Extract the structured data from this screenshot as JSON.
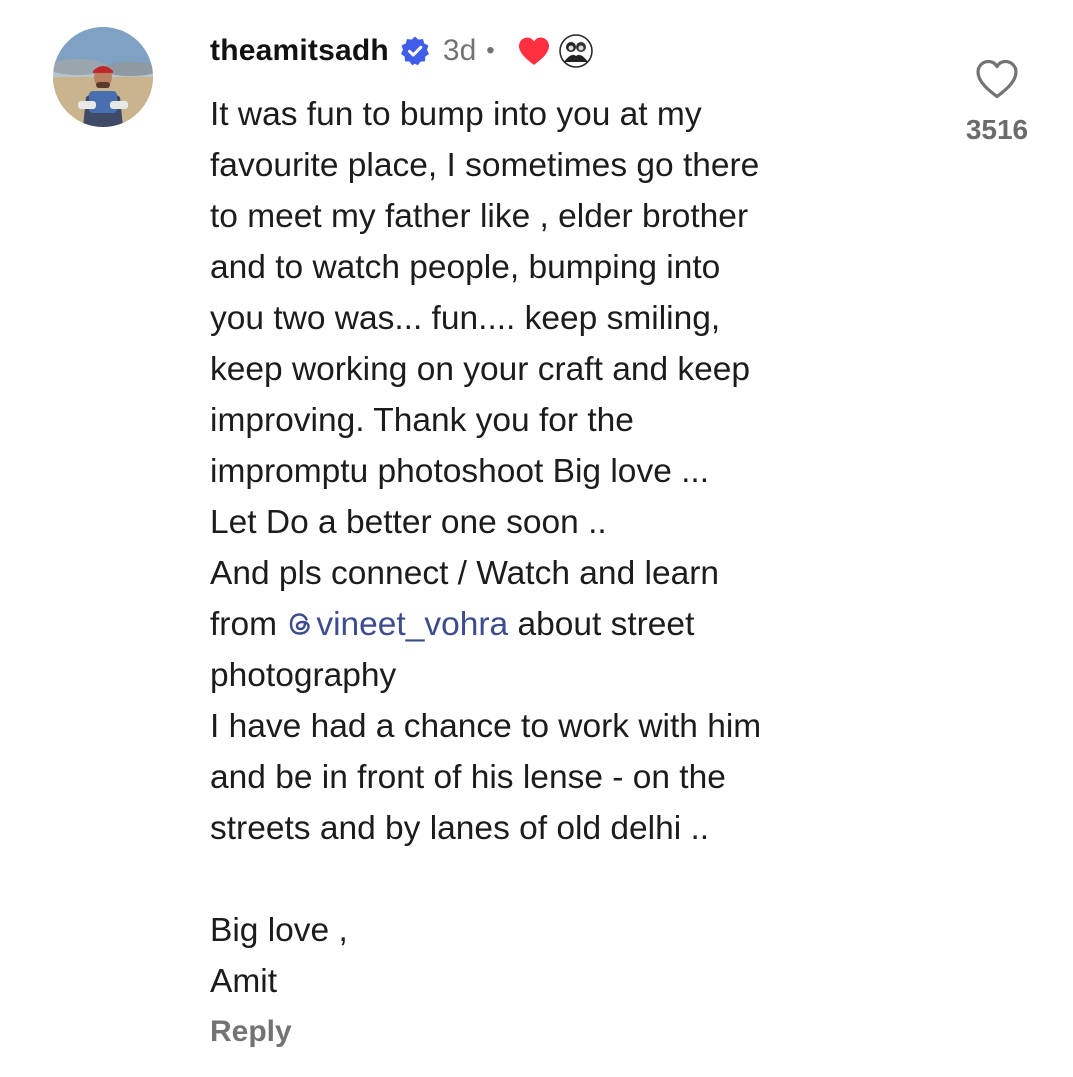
{
  "comment": {
    "username": "theamitsadh",
    "time_ago": "3d",
    "separator": "•",
    "body_part1": "It was fun to bump into you at my\nfavourite place, I sometimes go there\nto meet my father like , elder brother\nand to watch people, bumping into\nyou two was... fun.... keep smiling,\nkeep working on your craft and keep\nimproving. Thank you for the\nimpromptu photoshoot Big love ...\nLet Do a better one soon ..\nAnd pls connect / Watch and learn\nfrom ",
    "mention": "vineet_vohra",
    "body_part2": "  about street\nphotography\nI have had a chance to work with him\nand be in front of his lense - on the\nstreets and by lanes of old delhi ..\n\nBig love ,\nAmit",
    "reply_label": "Reply",
    "like_count": "3516"
  },
  "icons": {
    "avatar": "profile-photo",
    "verified": "verified-badge-icon",
    "creator_heart": "heart-filled-icon",
    "liker": "liker-avatar-icon",
    "mention": "threads-icon",
    "like": "heart-outline-icon"
  },
  "colors": {
    "verified_blue": "#3f5de8",
    "heart_red": "#ff3040",
    "mention_link": "#3d4b8f",
    "muted_text": "#737373"
  }
}
